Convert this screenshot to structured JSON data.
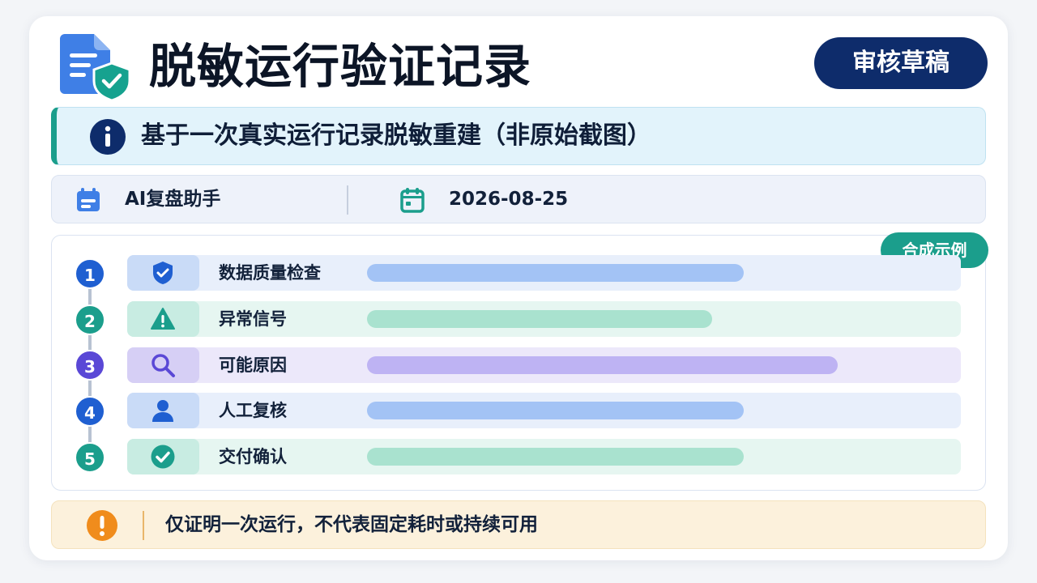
{
  "header": {
    "title": "脱敏运行验证记录",
    "status_button": "审核草稿",
    "icon": "document-shield-icon"
  },
  "info_banner": {
    "text": "基于一次真实运行记录脱敏重建（非原始截图）",
    "icon": "info-icon"
  },
  "meta": {
    "author": "AI复盘助手",
    "date": "2026-08-25",
    "author_icon": "calendar-icon",
    "date_icon": "calendar-icon"
  },
  "steps_panel": {
    "tag": "合成示例",
    "steps": [
      {
        "number": "1",
        "label": "数据质量检查",
        "icon": "shield-check-icon",
        "progress": 0.6,
        "color": "#1f5fd1"
      },
      {
        "number": "2",
        "label": "异常信号",
        "icon": "warning-icon",
        "progress": 0.55,
        "color": "#1b9e8c"
      },
      {
        "number": "3",
        "label": "可能原因",
        "icon": "search-icon",
        "progress": 0.75,
        "color": "#5a48d6"
      },
      {
        "number": "4",
        "label": "人工复核",
        "icon": "user-icon",
        "progress": 0.6,
        "color": "#1f5fd1"
      },
      {
        "number": "5",
        "label": "交付确认",
        "icon": "check-circle-icon",
        "progress": 0.6,
        "color": "#1b9e8c"
      }
    ]
  },
  "notice": {
    "text": "仅证明一次运行，不代表固定耗时或持续可用",
    "icon": "exclamation-icon"
  }
}
